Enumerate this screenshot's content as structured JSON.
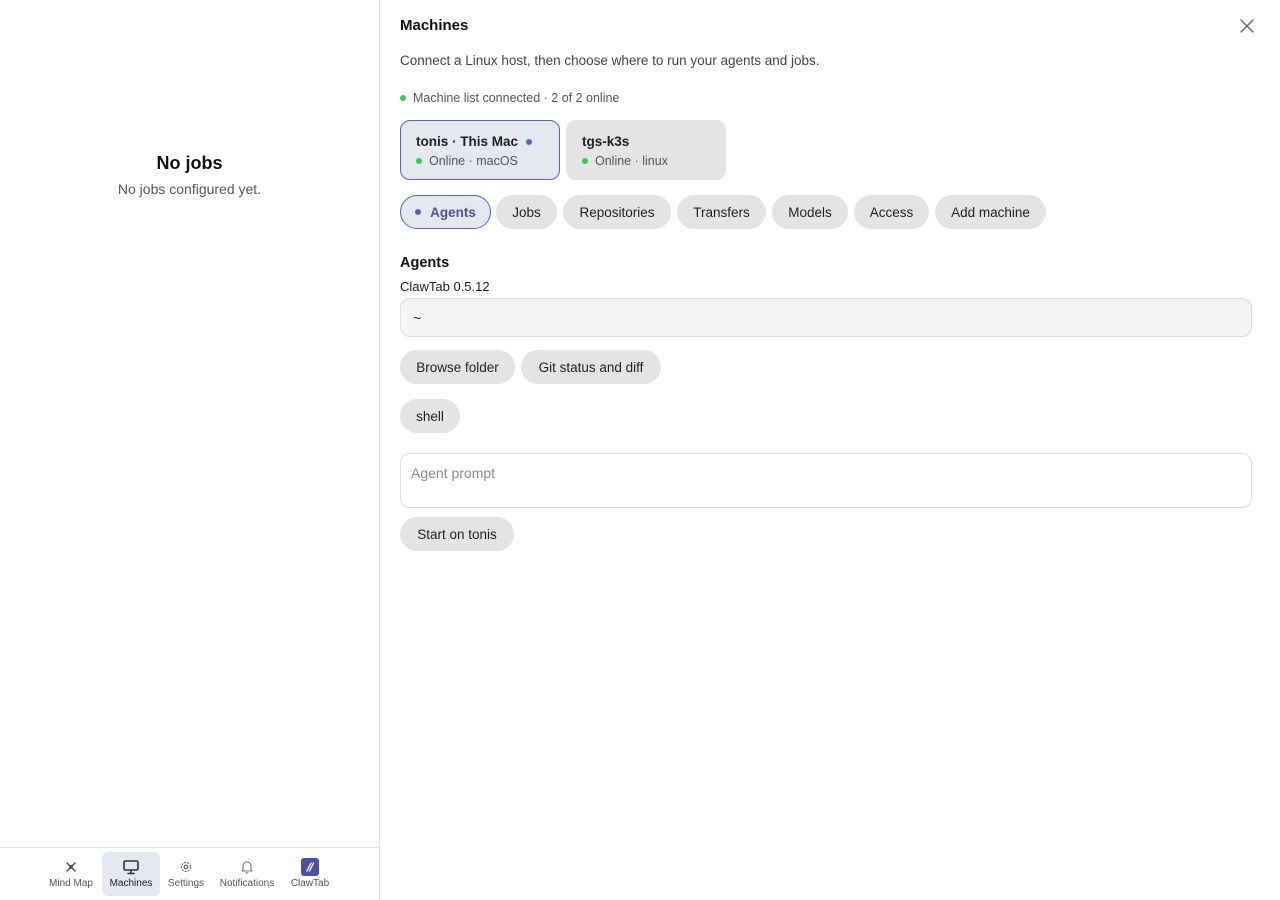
{
  "left": {
    "empty_title": "No jobs",
    "empty_subtitle": "No jobs configured yet.",
    "nav": {
      "mind_map": "Mind Map",
      "machines": "Machines",
      "settings": "Settings",
      "notifications": "Notifications",
      "clawtab": "ClawTab"
    }
  },
  "panel": {
    "title": "Machines",
    "subtitle": "Connect a Linux host, then choose where to run your agents and jobs.",
    "status": "Machine list connected · 2 of 2 online",
    "machines": [
      {
        "name": "tonis · This Mac",
        "status": "Online · macOS",
        "selected": true
      },
      {
        "name": "tgs-k3s",
        "status": "Online · linux",
        "selected": false
      }
    ],
    "tabs": {
      "agents": "Agents",
      "jobs": "Jobs",
      "repositories": "Repositories",
      "transfers": "Transfers",
      "models": "Models",
      "access": "Access",
      "add_machine": "Add machine"
    },
    "section_title": "Agents",
    "version": "ClawTab 0.5.12",
    "path_value": "~",
    "browse_folder": "Browse folder",
    "git_status": "Git status and diff",
    "shell": "shell",
    "prompt_placeholder": "Agent prompt",
    "start_button": "Start on tonis"
  },
  "colors": {
    "accent": "#5a5fc2",
    "online": "#34c759",
    "selected_bg": "#e6e8f0",
    "pill_bg": "#e4e4e4"
  },
  "icons": {
    "mind_map": "mind-map-icon",
    "machines": "monitor-icon",
    "settings": "gear-icon",
    "notifications": "bell-icon",
    "clawtab": "clawtab-logo-icon",
    "close": "close-icon"
  }
}
